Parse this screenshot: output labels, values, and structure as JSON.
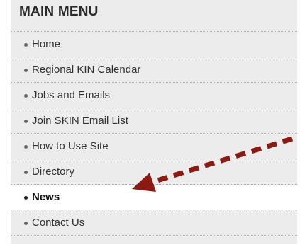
{
  "menu": {
    "title": "MAIN MENU",
    "items": [
      {
        "label": "Home"
      },
      {
        "label": "Regional KIN Calendar"
      },
      {
        "label": "Jobs and Emails"
      },
      {
        "label": "Join SKIN Email List"
      },
      {
        "label": "How to Use Site"
      },
      {
        "label": "Directory"
      },
      {
        "label": "News",
        "active": true
      },
      {
        "label": "Contact Us"
      }
    ]
  },
  "annotation": {
    "arrow_color": "#8b1a13",
    "arrow_style": "dashed",
    "points_to": "News"
  },
  "colors": {
    "panel_background": "#ececec",
    "active_item_background": "#ffffff",
    "divider": "#a9a9a9"
  }
}
